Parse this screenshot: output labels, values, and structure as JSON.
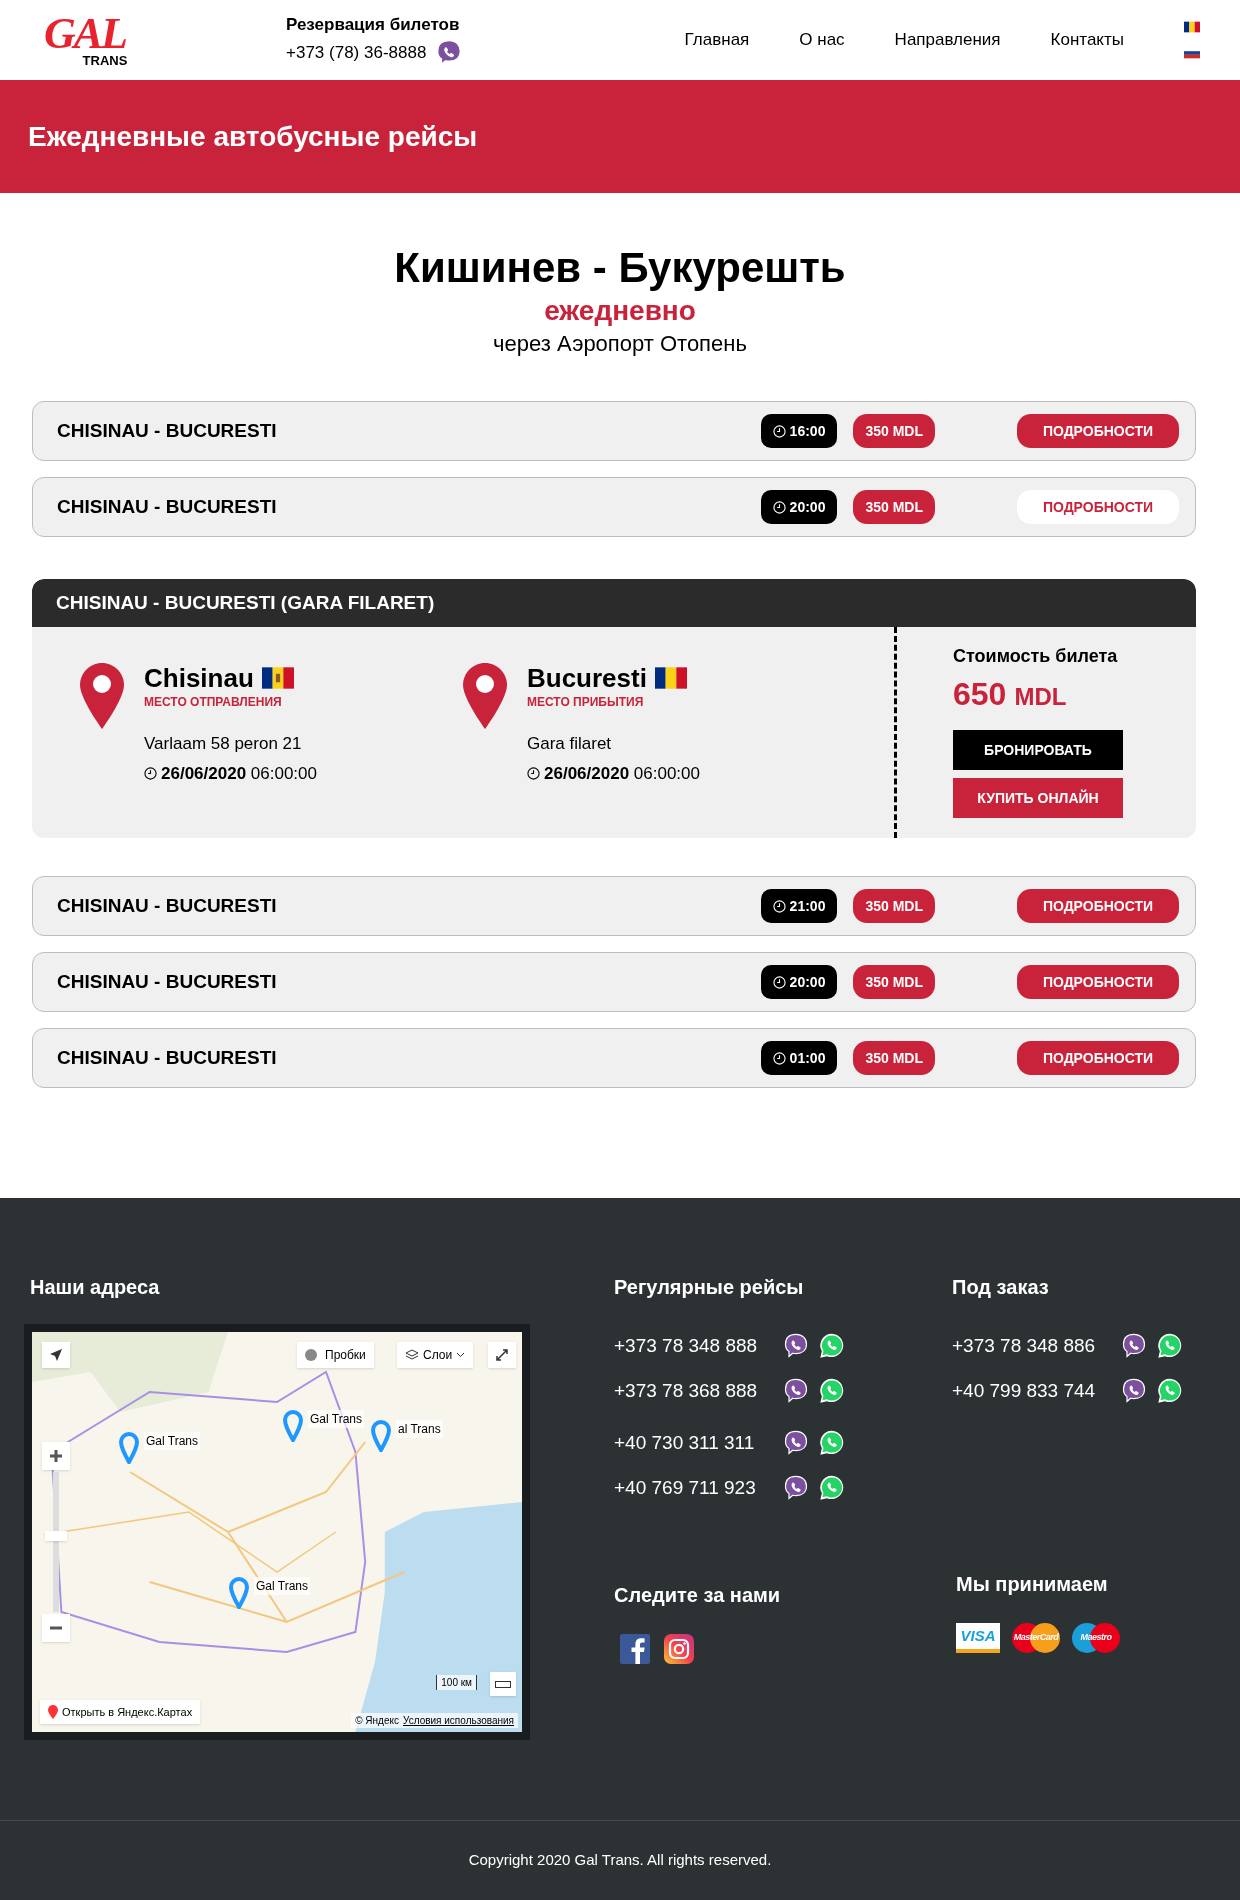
{
  "header": {
    "logo": {
      "main": "GAL",
      "sub": "TRANS"
    },
    "booking_title": "Резервация билетов",
    "booking_phone": "+373 (78) 36-8888",
    "nav": [
      "Главная",
      "О нас",
      "Направления",
      "Контакты"
    ],
    "languages": [
      {
        "kind": "ro"
      },
      {
        "kind": "ru"
      }
    ]
  },
  "banner": {
    "title": "Ежедневные автобусные рейсы"
  },
  "route": {
    "title": "Кишинев - Букурешть",
    "frequency": "ежедневно",
    "via": "через Аэропорт Отопень"
  },
  "trips": [
    {
      "kind": "row",
      "name": "CHISINAU - BUCURESTI",
      "time": "16:00",
      "price": "350 MDL",
      "button": "ПОДРОБНОСТИ",
      "highlighted": false
    },
    {
      "kind": "row",
      "name": "CHISINAU - BUCURESTI",
      "time": "20:00",
      "price": "350 MDL",
      "button": "ПОДРОБНОСТИ",
      "highlighted": true
    },
    {
      "kind": "details",
      "name": "CHISINAU - BUCURESTI (GARA FILARET)",
      "stops": [
        {
          "city": "Chisinau",
          "flag": {
            "kind": "md"
          },
          "role": "МЕСТО ОТПРАВЛЕНИЯ",
          "address": "Varlaam 58 peron 21",
          "date": "26/06/2020",
          "time": "06:00:00"
        },
        {
          "city": "Bucuresti",
          "flag": {
            "kind": "ro"
          },
          "role": "МЕСТО ПРИБЫТИЯ",
          "address": "Gara filaret",
          "date": "26/06/2020",
          "time": "06:00:00"
        }
      ],
      "price_label": "Стоимость билета",
      "price": "650",
      "currency": "MDL",
      "buttons": [
        {
          "kind": "book",
          "label": "БРОНИРОВАТЬ"
        },
        {
          "kind": "buy",
          "label": "КУПИТЬ ОНЛАЙН"
        }
      ]
    },
    {
      "kind": "row",
      "name": "CHISINAU - BUCURESTI",
      "time": "21:00",
      "price": "350 MDL",
      "button": "ПОДРОБНОСТИ",
      "highlighted": false
    },
    {
      "kind": "row",
      "name": "CHISINAU - BUCURESTI",
      "time": "20:00",
      "price": "350 MDL",
      "button": "ПОДРОБНОСТИ",
      "highlighted": false
    },
    {
      "kind": "row",
      "name": "CHISINAU - BUCURESTI",
      "time": "01:00",
      "price": "350 MDL",
      "button": "ПОДРОБНОСТИ",
      "highlighted": false
    }
  ],
  "footer": {
    "addresses_title": "Наши адреса",
    "map": {
      "zoom": {
        "level": 0.55
      },
      "traffic": "Пробки",
      "layers": "Слои",
      "open": "Открыть в Яндекс.Картах",
      "scale": "100 км",
      "copyright": "© Яндекс",
      "terms": "Условия использования",
      "pins": [
        "Gal Trans",
        "Gal Trans",
        "al Trans",
        "Gal Trans"
      ]
    },
    "regular_title": "Регулярные рейсы",
    "regular_phones": [
      "+373 78 348 888",
      "+373 78 368 888",
      "+40 730 311 311",
      "+40 769 711 923"
    ],
    "order_title": "Под заказ",
    "order_phones": [
      "+373 78 348 886",
      "+40 799 833 744"
    ],
    "follow_title": "Следите за нами",
    "social": [
      {
        "kind": "facebook"
      },
      {
        "kind": "instagram"
      }
    ],
    "accept_title": "Мы принимаем",
    "cards": [
      {
        "kind": "visa",
        "label": "VISA"
      },
      {
        "kind": "mastercard",
        "label": "MasterCard"
      },
      {
        "kind": "maestro",
        "label": "Maestro"
      }
    ],
    "copyright": "Copyright 2020 Gal Trans. All rights reserved."
  }
}
